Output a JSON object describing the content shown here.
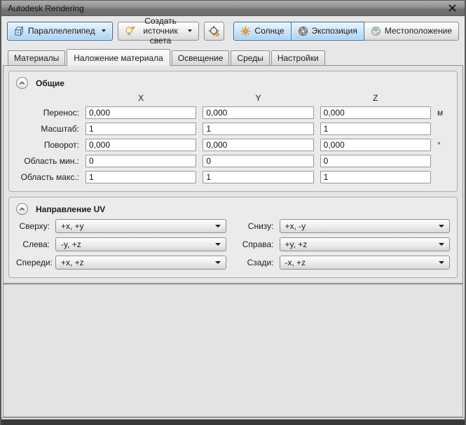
{
  "window": {
    "title": "Autodesk Rendering"
  },
  "toolbar": {
    "geometry": "Параллелепипед",
    "create_light": "Создать источник света",
    "sun": "Солнце",
    "exposure": "Экспозиция",
    "location": "Местоположение"
  },
  "tabs": [
    {
      "label": "Материалы",
      "active": false
    },
    {
      "label": "Наложение материала",
      "active": true
    },
    {
      "label": "Освещение",
      "active": false
    },
    {
      "label": "Среды",
      "active": false
    },
    {
      "label": "Настройки",
      "active": false
    }
  ],
  "general": {
    "title": "Общие",
    "columns": [
      "X",
      "Y",
      "Z"
    ],
    "rows": [
      {
        "label": "Перенос:",
        "x": "0,000",
        "y": "0,000",
        "z": "0,000",
        "unit": "м"
      },
      {
        "label": "Масштаб:",
        "x": "1",
        "y": "1",
        "z": "1",
        "unit": ""
      },
      {
        "label": "Поворот:",
        "x": "0,000",
        "y": "0,000",
        "z": "0,000",
        "unit": "°"
      },
      {
        "label": "Область мин.:",
        "x": "0",
        "y": "0",
        "z": "0",
        "unit": ""
      },
      {
        "label": "Область макс.:",
        "x": "1",
        "y": "1",
        "z": "1",
        "unit": ""
      }
    ]
  },
  "uv": {
    "title": "Направление UV",
    "rows": [
      {
        "left_label": "Сверху:",
        "left_value": "+x, +y",
        "right_label": "Снизу:",
        "right_value": "+x, -y"
      },
      {
        "left_label": "Слева:",
        "left_value": "-y, +z",
        "right_label": "Справа:",
        "right_value": "+y, +z"
      },
      {
        "left_label": "Спереди:",
        "left_value": "+x, +z",
        "right_label": "Сзади:",
        "right_value": "-x, +z"
      }
    ]
  },
  "colors": {
    "accent_border": "#2f6699",
    "active_button_bg": "#cde5f7",
    "titlebar_top": "#aeaeae",
    "titlebar_bottom": "#6c6c6c",
    "panel_bg": "#e4e4e4",
    "sun_orange": "#f2a33c",
    "bottom_bar": "#3a3a3a"
  }
}
